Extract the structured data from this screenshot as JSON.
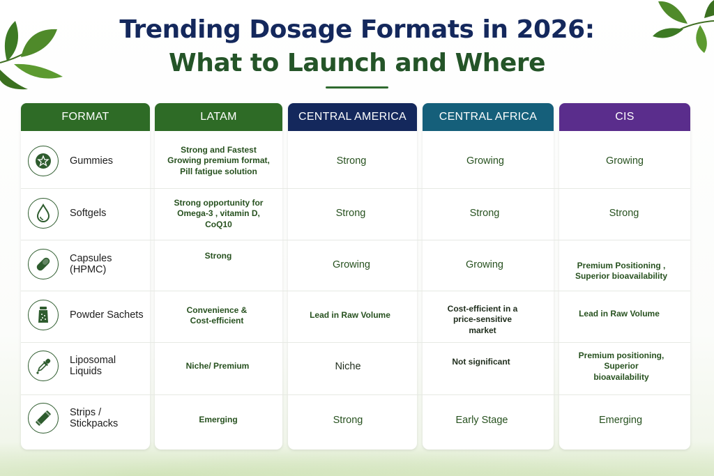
{
  "title": {
    "line1": "Trending Dosage Formats in 2026:",
    "line2": "What to Launch and Where"
  },
  "colors": {
    "title_navy": "#14285c",
    "title_green": "#245428",
    "format_header": "#2e6b26",
    "latam_header": "#2e6b26",
    "central_america_header": "#14285c",
    "central_africa_header": "#155f7a",
    "cis_header": "#5a2d8c",
    "cell_text": "#27511f"
  },
  "table": {
    "headers": {
      "format": "FORMAT",
      "latam": "LATAM",
      "central_america": "CENTRAL AMERICA",
      "central_africa": "CENTRAL AFRICA",
      "cis": "CIS"
    },
    "rows": [
      {
        "format": "Gummies",
        "icon": "star-badge-icon",
        "latam": [
          "Strong  and Fastest",
          "Growing premium format,",
          "Pill fatigue solution"
        ],
        "central_america": "Strong",
        "central_africa": "Growing",
        "cis": "Growing"
      },
      {
        "format": "Softgels",
        "icon": "droplet-icon",
        "latam": [
          "Strong  opportunity for",
          "Omega-3 , vitamin D,",
          "CoQ10"
        ],
        "central_america": "Strong",
        "central_africa": "Strong",
        "cis": "Strong"
      },
      {
        "format": "Capsules (HPMC)",
        "icon": "capsule-icon",
        "latam": "Strong",
        "central_america": "Growing",
        "central_africa": "Growing",
        "cis": [
          "Premium Positioning ,",
          "Superior bioavailability"
        ]
      },
      {
        "format": "Powder Sachets",
        "icon": "powder-jar-icon",
        "latam": [
          "Convenience &",
          "Cost-efficient"
        ],
        "central_america": "Lead in Raw Volume",
        "central_africa": [
          "Cost-efficient in a",
          "price-sensitive",
          "market"
        ],
        "cis": "Lead in Raw Volume"
      },
      {
        "format": "Liposomal Liquids",
        "icon": "dropper-icon",
        "latam": "Niche/ Premium",
        "central_america": "Niche",
        "central_africa": "Not significant",
        "cis": [
          "Premium positioning,",
          "Superior",
          "bioavailability"
        ]
      },
      {
        "format": "Strips / Stickpacks",
        "icon": "stickpack-icon",
        "latam": "Emerging",
        "central_america": "Strong",
        "central_africa": "Early Stage",
        "cis": "Emerging"
      }
    ]
  }
}
